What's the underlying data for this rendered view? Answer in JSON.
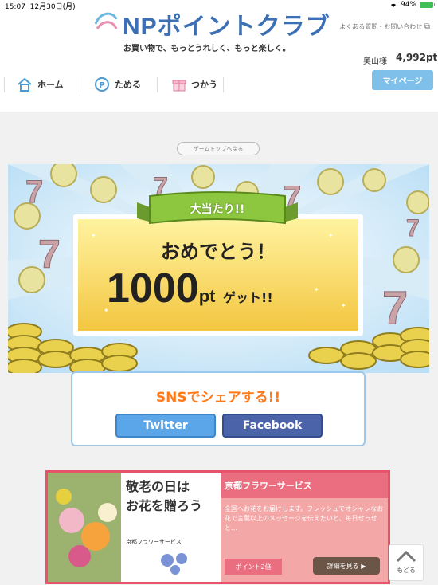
{
  "status_bar": {
    "time": "15:07",
    "date": "12月30日(月)",
    "battery": "94%"
  },
  "header": {
    "logo": "NPポイントクラブ",
    "tagline": "お買い物で、もっとうれしく、もっと楽しく。",
    "faq_link": "よくある質問・お問い合わせ",
    "user_name": "奥山様",
    "points": "4,992pt",
    "mypage_label": "マイページ"
  },
  "nav": {
    "items": [
      {
        "label": "ホーム",
        "icon": "house-icon"
      },
      {
        "label": "ためる",
        "icon": "point-coin-icon"
      },
      {
        "label": "つかう",
        "icon": "gift-icon"
      }
    ]
  },
  "back_to_game": "ゲームトップへ戻る",
  "banner": {
    "ribbon": "大当たり!!",
    "congrats": "おめでとう！",
    "amount": "1000",
    "unit": "pt",
    "get": "ゲット!!"
  },
  "share": {
    "title": "SNSでシェアする!!",
    "twitter_label": "Twitter",
    "facebook_label": "Facebook"
  },
  "ad": {
    "headline_1": "敬老の日は",
    "headline_2": "お花を贈ろう",
    "logo_text": "京都フラワーサービス",
    "shop_name": "京都フラワーサービス",
    "description": "全国へお花をお届けします。フレッシュでオシャレなお花で言葉以上のメッセージを伝えたいと、毎日せっせと…",
    "points_label": "ポイント2倍",
    "detail_label": "詳細を見る"
  },
  "back_top_label": "もどる",
  "colors": {
    "brand_blue": "#3d6fb5",
    "accent_sky": "#7fc0ea",
    "share_orange": "#ff7a1a",
    "twitter_blue": "#5aa6e8",
    "facebook_blue": "#4a63a9",
    "ad_pink": "#e8536c"
  }
}
